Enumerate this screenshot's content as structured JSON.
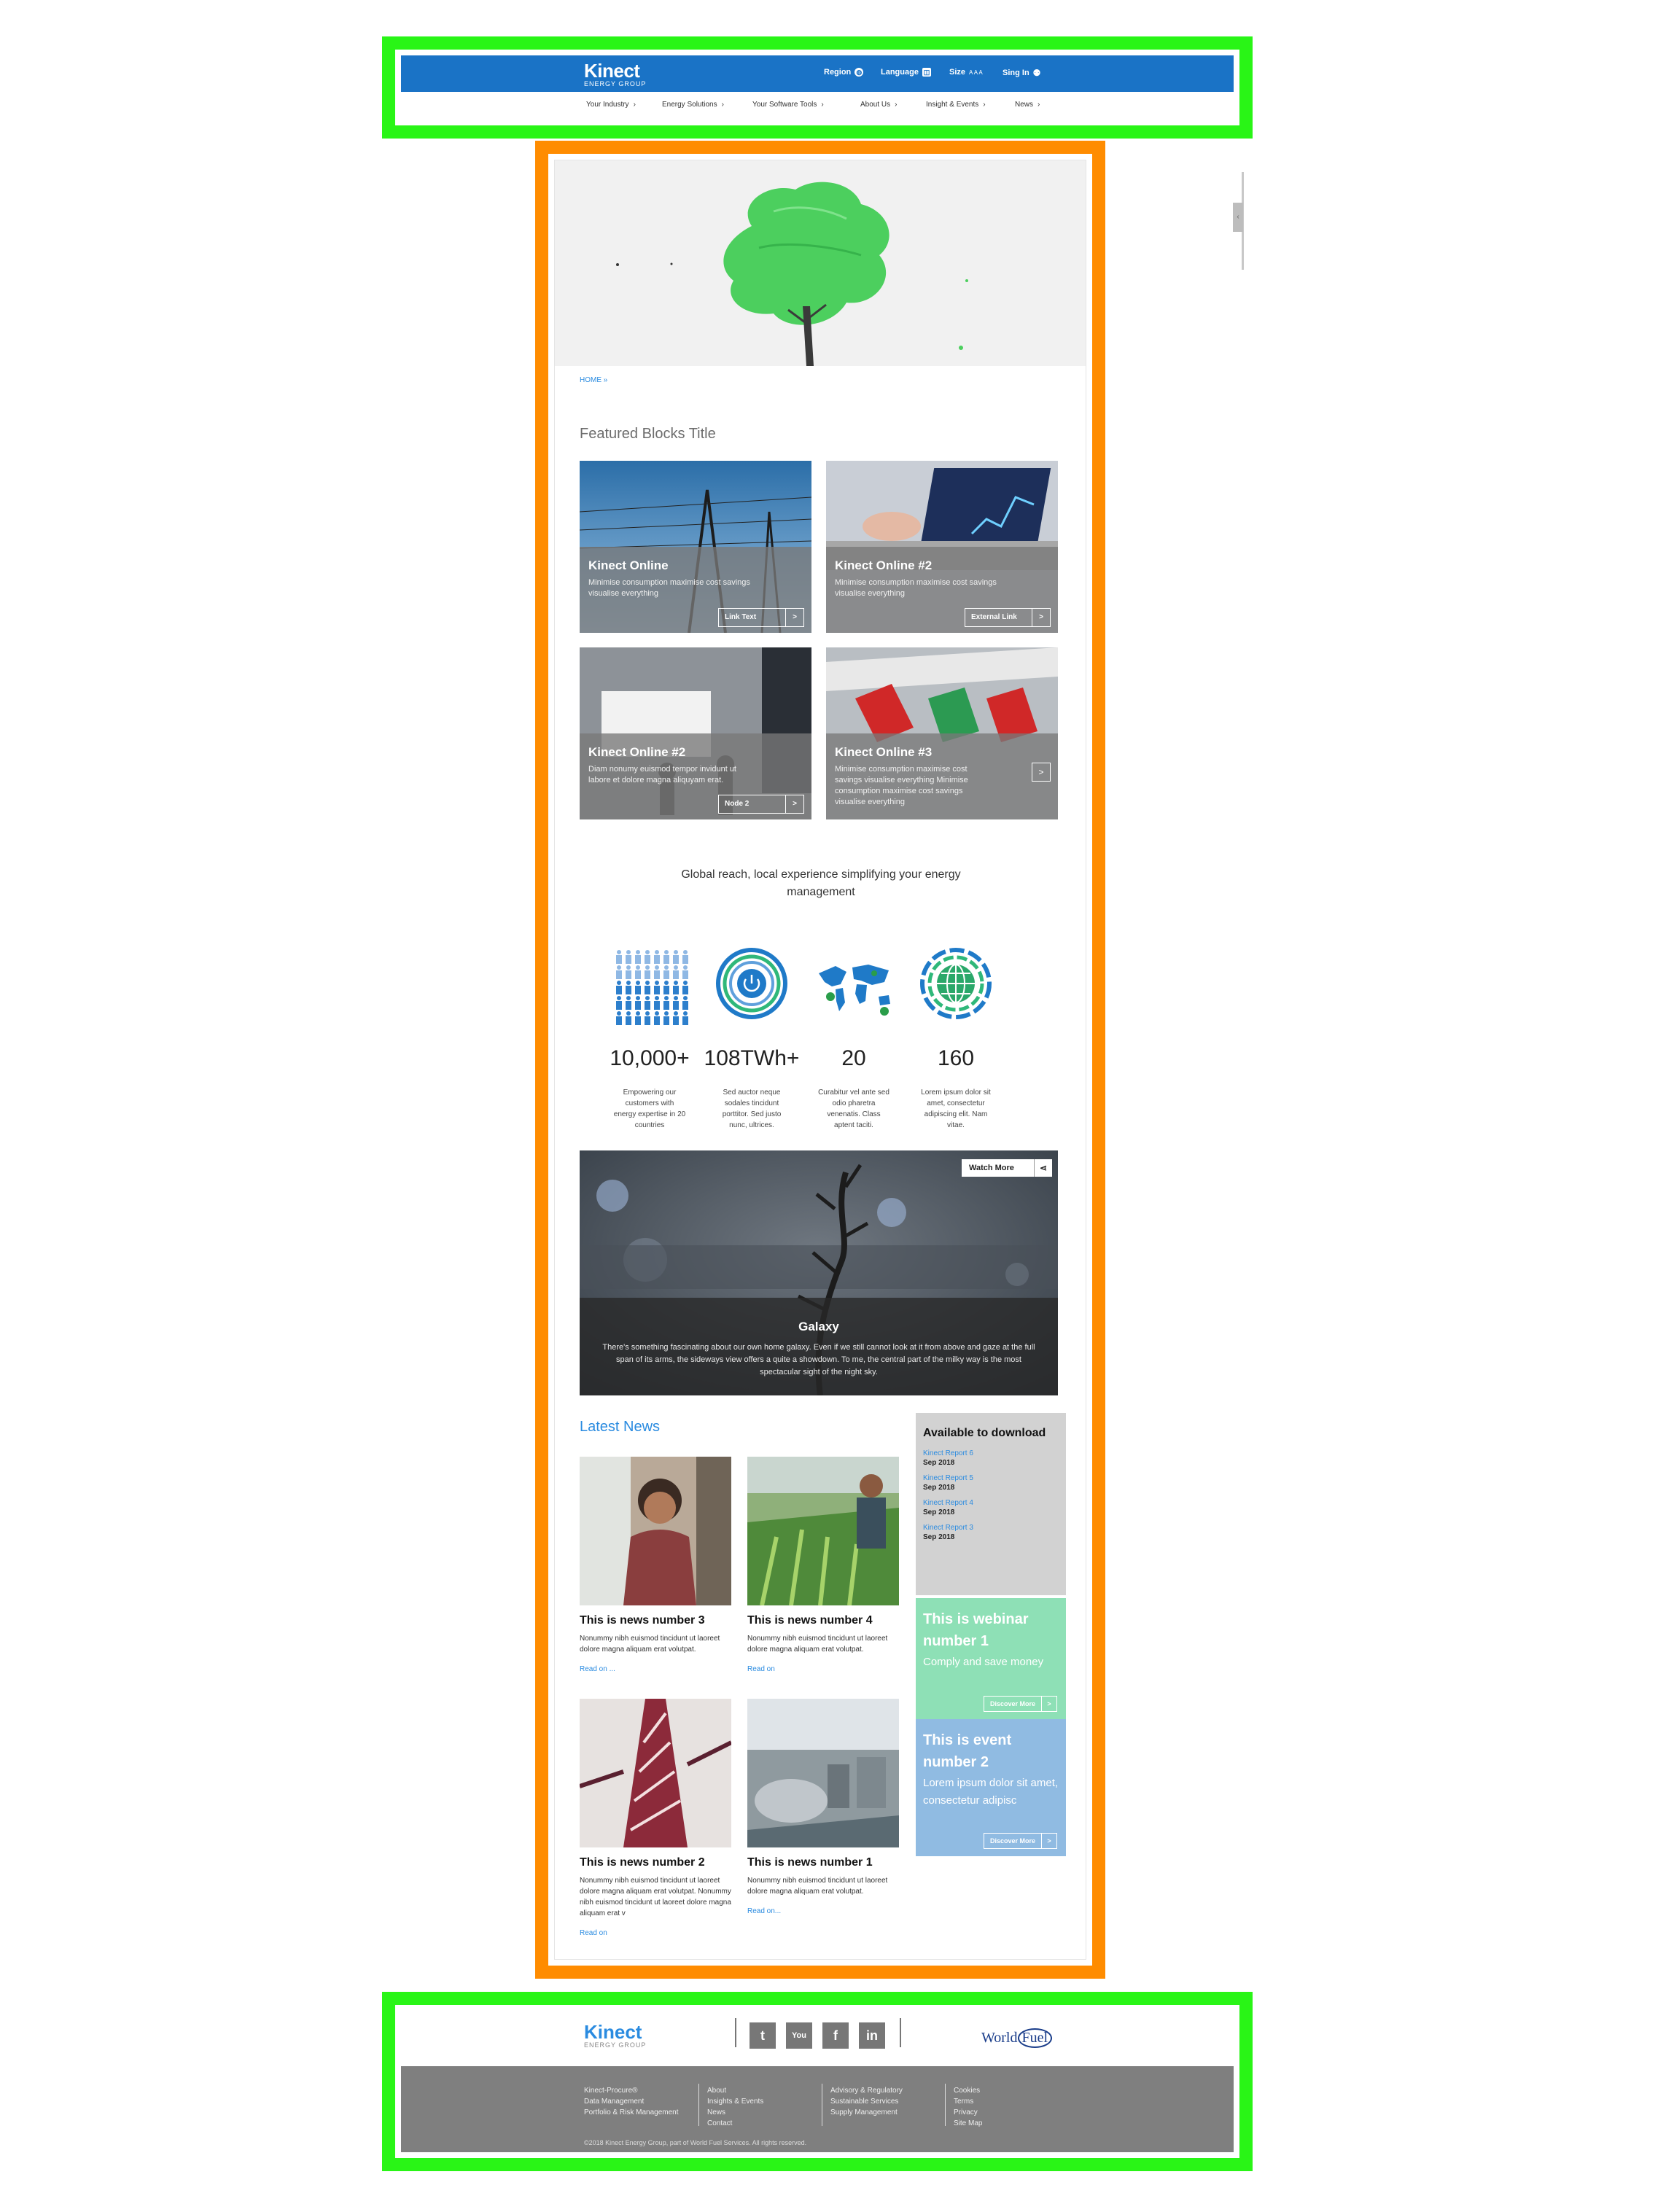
{
  "header": {
    "logo_name": "Kinect",
    "logo_sub": "ENERGY GROUP",
    "util": [
      {
        "label": "Region",
        "icon": "globe-icon"
      },
      {
        "label": "Language",
        "icon": "language-icon"
      },
      {
        "label": "Size",
        "icon": "text-size-icon",
        "extra": "A A A"
      },
      {
        "label": "Sing In",
        "icon": "user-icon"
      }
    ],
    "nav": [
      "Your Industry",
      "Energy Solutions",
      "Your Software Tools",
      "About Us",
      "Insight & Events",
      "News"
    ]
  },
  "breadcrumb": "HOME »",
  "featured": {
    "title": "Featured Blocks Title",
    "cards": [
      {
        "title": "Kinect Online",
        "desc": "Minimise consumption maximise cost savings visualise everything",
        "button": "Link Text",
        "arrow": ">"
      },
      {
        "title": "Kinect Online #2",
        "desc": "Minimise consumption maximise cost savings visualise everything",
        "button": "External Link",
        "arrow": ">"
      },
      {
        "title": "Kinect Online #2",
        "desc": "Diam nonumy euismod tempor invidunt ut labore et dolore magna aliquyam erat.",
        "button": "Node 2",
        "arrow": ">"
      },
      {
        "title": "Kinect Online #3",
        "desc": "Minimise consumption maximise cost savings visualise everything Minimise consumption maximise cost savings visualise everything",
        "button": "",
        "arrow": ">"
      }
    ]
  },
  "tagline": "Global reach, local experience simplifying your energy management",
  "stats": [
    {
      "value": "10,000+",
      "desc": "Empowering our customers with energy expertise in 20 countries",
      "icon": "people-icon"
    },
    {
      "value": "108TWh+",
      "desc": "Sed auctor neque sodales tincidunt porttitor. Sed justo nunc, ultrices.",
      "icon": "power-icon"
    },
    {
      "value": "20",
      "desc": "Curabitur vel ante sed odio pharetra venenatis. Class aptent taciti.",
      "icon": "world-map-icon"
    },
    {
      "value": "160",
      "desc": "Lorem ipsum dolor sit amet, consectetur adipiscing elit. Nam vitae.",
      "icon": "globe-grid-icon"
    }
  ],
  "video": {
    "watch": "Watch More",
    "title": "Galaxy",
    "desc": "There's something fascinating about our own home galaxy. Even if we still cannot look at it from above and gaze at the full span of its arms, the sideways view offers a quite a showdown. To me, the central part of the milky way is the most spectacular sight of the night sky."
  },
  "news": {
    "title": "Latest News",
    "items": [
      {
        "title": "This is news number 3",
        "desc": "Nonummy nibh euismod tincidunt ut laoreet dolore magna aliquam erat volutpat.",
        "read": "Read on ..."
      },
      {
        "title": "This is news number 4",
        "desc": "Nonummy nibh euismod tincidunt ut laoreet dolore magna aliquam erat volutpat.",
        "read": "Read on"
      },
      {
        "title": "This is news number 2",
        "desc": "Nonummy nibh euismod tincidunt ut laoreet dolore magna aliquam erat volutpat. Nonummy nibh euismod tincidunt ut laoreet dolore magna aliquam erat v",
        "read": "Read on"
      },
      {
        "title": "This is news number 1",
        "desc": "Nonummy nibh euismod tincidunt ut laoreet dolore magna aliquam erat volutpat.",
        "read": "Read on..."
      }
    ]
  },
  "downloads": {
    "title": "Available to download",
    "items": [
      {
        "link": "Kinect Report 6",
        "date": "Sep 2018"
      },
      {
        "link": "Kinect Report 5",
        "date": "Sep 2018"
      },
      {
        "link": "Kinect Report 4",
        "date": "Sep 2018"
      },
      {
        "link": "Kinect Report 3",
        "date": "Sep 2018"
      }
    ]
  },
  "promos": {
    "webinar": {
      "title": "This is webinar number 1",
      "text": "Comply and save money",
      "button": "Discover More",
      "arrow": ">"
    },
    "event": {
      "title": "This is event number 2",
      "text": "Lorem ipsum dolor sit amet, consectetur adipisc",
      "button": "Discover More",
      "arrow": ">"
    }
  },
  "footer": {
    "logo_name": "Kinect",
    "logo_sub": "ENERGY GROUP",
    "social": [
      "twitter-icon",
      "youtube-icon",
      "facebook-icon",
      "linkedin-icon"
    ],
    "partner_pre": "World",
    "partner_mark": "Fuel",
    "col1": [
      "Kinect-Procure®",
      "Data Management",
      "Portfolio & Risk Management"
    ],
    "col2": [
      "About",
      "Insights & Events",
      "News",
      "Contact"
    ],
    "col3": [
      "Advisory & Regulatory",
      "Sustainable Services",
      "Supply Management"
    ],
    "col4": [
      "Cookies",
      "Terms",
      "Privacy",
      "Site Map"
    ],
    "copyright": "©2018 Kinect Energy Group, part of World Fuel Services. All rights reserved."
  },
  "colors": {
    "brand_blue": "#1a73c6",
    "link_blue": "#2a8be0",
    "webinar_green": "#8ee0b6",
    "event_blue": "#90bbe2",
    "footer_gray": "#7f7f7f"
  }
}
